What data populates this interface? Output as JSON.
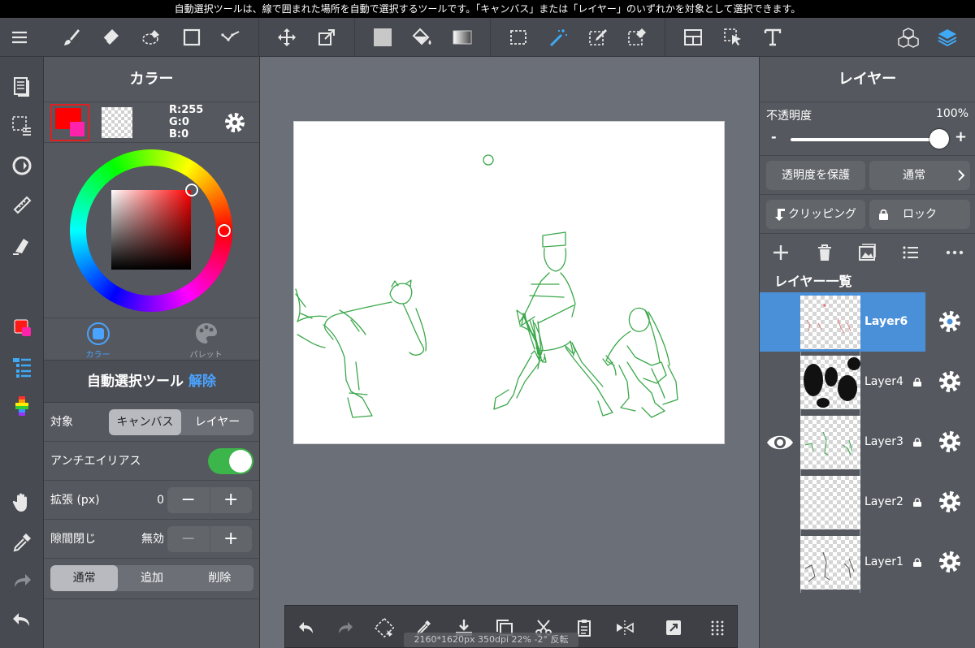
{
  "hint_text": "自動選択ツールは、線で囲まれた場所を自動で選択するツールです。「キャンバス」または「レイヤー」のいずれかを対象として選択できます。",
  "toolbar": {
    "tools": [
      "menu",
      "brush",
      "eraser",
      "lasso-eraser",
      "rectangle",
      "polyline",
      "move",
      "transform",
      "fill-color",
      "bucket",
      "gradient",
      "select-rect",
      "magic-wand",
      "select-pen",
      "select-eraser",
      "layout",
      "select-arrow",
      "text",
      "3d-cubes",
      "layers"
    ]
  },
  "color_panel": {
    "title": "カラー",
    "r": "R:255",
    "g": "G:0",
    "b": "B:0",
    "foreground_color": "#ff0000",
    "secondary_color": "#ff22aa",
    "tab_color_label": "カラー",
    "tab_palette_label": "パレット"
  },
  "tool_panel": {
    "title": "自動選択ツール",
    "release_label": "解除",
    "target_label": "対象",
    "target_options": [
      "キャンバス",
      "レイヤー"
    ],
    "target_selected": "キャンバス",
    "antialias_label": "アンチエイリアス",
    "antialias_on": true,
    "expand_label": "拡張 (px)",
    "expand_value": "0",
    "gap_label": "隙間閉じ",
    "gap_value": "無効",
    "mode_options": [
      "通常",
      "追加",
      "削除"
    ],
    "mode_selected": "通常"
  },
  "canvas_info": "2160*1620px 350dpi 22% -2° 反転",
  "layer_panel": {
    "title": "レイヤー",
    "opacity_label": "不透明度",
    "opacity_value": "100%",
    "minus": "-",
    "plus": "+",
    "protect_alpha_label": "透明度を保護",
    "blend_mode_label": "通常",
    "clipping_label": "クリッピング",
    "lock_label": "ロック",
    "list_title": "レイヤー一覧",
    "layers": [
      {
        "name": "Layer6",
        "selected": true,
        "locked": false,
        "visible_icon": false
      },
      {
        "name": "Layer4",
        "selected": false,
        "locked": true,
        "visible_icon": false
      },
      {
        "name": "Layer3",
        "selected": false,
        "locked": true,
        "visible_icon": true
      },
      {
        "name": "Layer2",
        "selected": false,
        "locked": true,
        "visible_icon": false
      },
      {
        "name": "Layer1",
        "selected": false,
        "locked": true,
        "visible_icon": false
      }
    ]
  },
  "colors": {
    "accent_blue": "#4a90d9",
    "toggle_green": "#3cb54a",
    "sketch_green": "#3aa84a"
  }
}
